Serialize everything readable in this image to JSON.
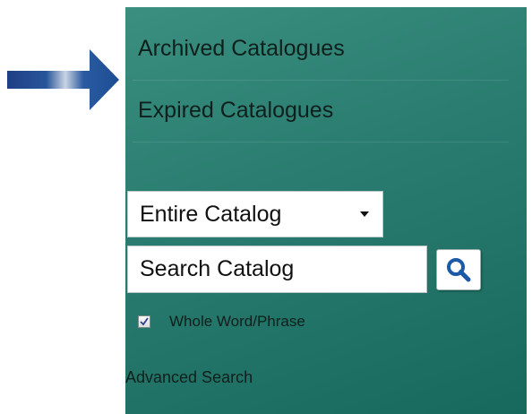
{
  "nav": {
    "items": [
      {
        "label": "Archived Catalogues"
      },
      {
        "label": "Expired Catalogues"
      }
    ]
  },
  "search": {
    "scope_selected": "Entire Catalog",
    "placeholder": "Search Catalog",
    "whole_word_label": "Whole Word/Phrase",
    "whole_word_checked": true,
    "advanced_label": "Advanced Search"
  },
  "icons": {
    "pointer": "arrow-right-icon",
    "search": "magnifier-icon",
    "caret": "chevron-down-icon",
    "check": "checkmark-icon"
  },
  "colors": {
    "panel_top": "#3a8f80",
    "panel_bottom": "#17695d",
    "arrow": "#1f4f8f",
    "search_icon": "#1c5aa8"
  }
}
